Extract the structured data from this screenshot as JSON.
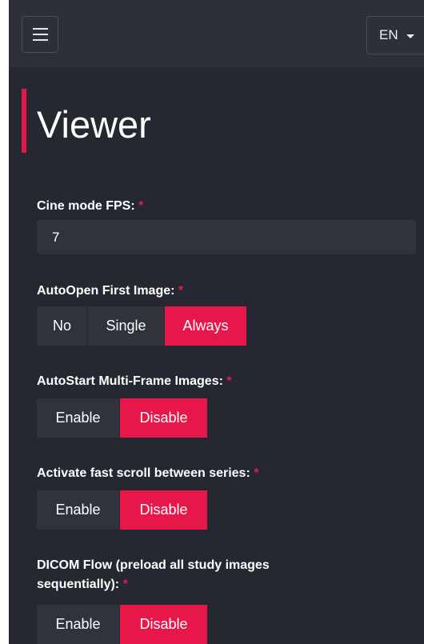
{
  "header": {
    "menu_icon": "hamburger-menu-icon",
    "language": "EN"
  },
  "page": {
    "title": "Viewer"
  },
  "settings": {
    "cine_fps": {
      "label": "Cine mode FPS:",
      "required": "*",
      "value": "7"
    },
    "auto_open": {
      "label": "AutoOpen First Image:",
      "required": "*",
      "options": [
        "No",
        "Single",
        "Always"
      ],
      "selected": "Always"
    },
    "autostart_multiframe": {
      "label": "AutoStart Multi-Frame Images:",
      "required": "*",
      "options": [
        "Enable",
        "Disable"
      ],
      "selected": "Disable"
    },
    "fast_scroll": {
      "label": "Activate fast scroll between series:",
      "required": "*",
      "options": [
        "Enable",
        "Disable"
      ],
      "selected": "Disable"
    },
    "dicom_flow": {
      "label_line1": "DICOM Flow (preload all study images",
      "label_line2": "sequentially):",
      "required": "*",
      "options": [
        "Enable",
        "Disable"
      ],
      "selected": "Disable"
    }
  },
  "colors": {
    "accent": "#e8174a",
    "background": "#252830",
    "topbar": "#2d3039",
    "control": "#30333c"
  }
}
